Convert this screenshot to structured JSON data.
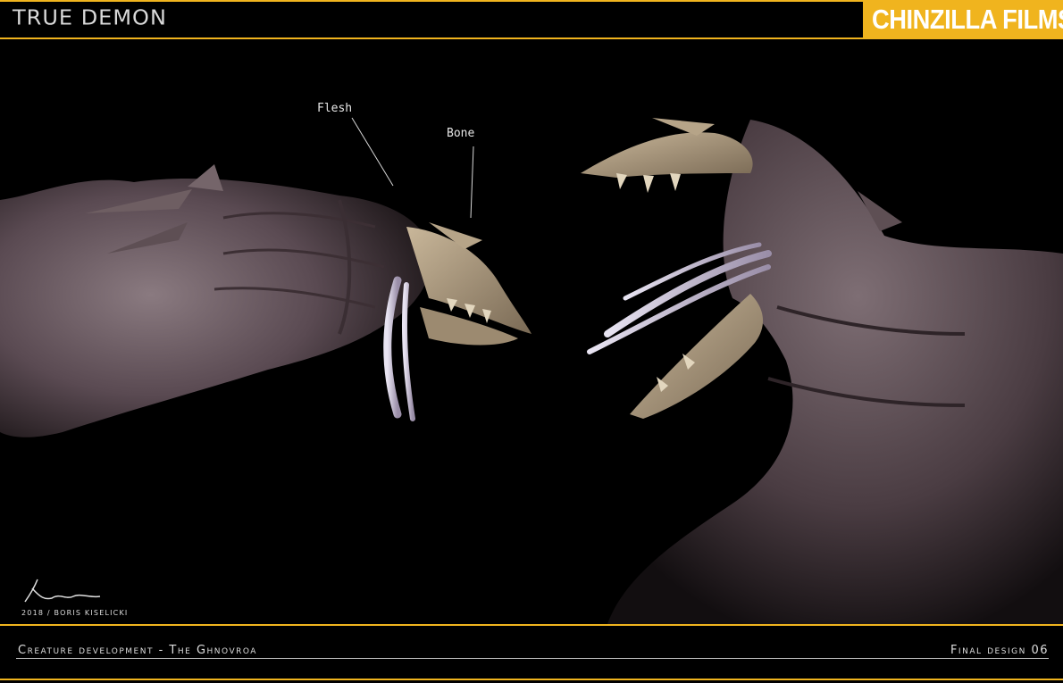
{
  "header": {
    "title": "TRUE DEMON",
    "brand": "CHINZILLA FILMS"
  },
  "labels": {
    "flesh": "Flesh",
    "bone": "Bone"
  },
  "signature": {
    "credit": "2018 / BORIS KISELICKI"
  },
  "footer": {
    "caption_left": "Creature development  -  The Ghnovroa",
    "caption_right": "Final design 06"
  },
  "colors": {
    "accent": "#f0b41e",
    "background": "#000000"
  }
}
